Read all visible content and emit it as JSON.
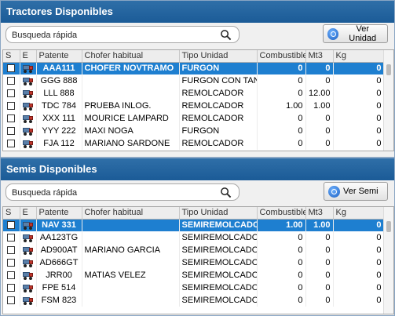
{
  "tractores": {
    "title": "Tractores Disponibles",
    "search_placeholder": "Busqueda rápida",
    "button_label": "Ver Unidad",
    "columns": [
      "S",
      "E",
      "Patente",
      "Chofer habitual",
      "Tipo Unidad",
      "Combustible",
      "Mt3",
      "Kg"
    ],
    "rows": [
      {
        "patente": "AAA111",
        "chofer": "CHOFER NOVTRAMO",
        "tipo": "FURGON",
        "combustible": "0",
        "mt3": "0",
        "kg": "0",
        "selected": true
      },
      {
        "patente": "GGG 888",
        "chofer": "",
        "tipo": "FURGON CON TANQUE",
        "combustible": "0",
        "mt3": "0",
        "kg": "0"
      },
      {
        "patente": "LLL 888",
        "chofer": "",
        "tipo": "REMOLCADOR",
        "combustible": "0",
        "mt3": "12.00",
        "kg": "0"
      },
      {
        "patente": "TDC 784",
        "chofer": "PRUEBA INLOG.",
        "tipo": "REMOLCADOR",
        "combustible": "1.00",
        "mt3": "1.00",
        "kg": "0"
      },
      {
        "patente": "XXX 111",
        "chofer": "MOURICE LAMPARD",
        "tipo": "REMOLCADOR",
        "combustible": "0",
        "mt3": "0",
        "kg": "0"
      },
      {
        "patente": "YYY 222",
        "chofer": "MAXI NOGA",
        "tipo": "FURGON",
        "combustible": "0",
        "mt3": "0",
        "kg": "0"
      },
      {
        "patente": "FJA 112",
        "chofer": "MARIANO SARDONE",
        "tipo": "REMOLCADOR",
        "combustible": "0",
        "mt3": "0",
        "kg": "0"
      }
    ]
  },
  "semis": {
    "title": "Semis Disponibles",
    "search_placeholder": "Busqueda rápida",
    "button_label": "Ver Semi",
    "columns": [
      "S",
      "E",
      "Patente",
      "Chofer habitual",
      "Tipo Unidad",
      "Combustible",
      "Mt3",
      "Kg"
    ],
    "rows": [
      {
        "patente": "NAV 331",
        "chofer": "",
        "tipo": "SEMIREMOLCADOR",
        "combustible": "1.00",
        "mt3": "1.00",
        "kg": "0",
        "selected": true
      },
      {
        "patente": "AA123TG",
        "chofer": "",
        "tipo": "SEMIREMOLCADOR",
        "combustible": "0",
        "mt3": "0",
        "kg": "0"
      },
      {
        "patente": "AD900AT",
        "chofer": "MARIANO GARCIA",
        "tipo": "SEMIREMOLCADOR",
        "combustible": "0",
        "mt3": "0",
        "kg": "0"
      },
      {
        "patente": "AD666GT",
        "chofer": "",
        "tipo": "SEMIREMOLCADOR",
        "combustible": "0",
        "mt3": "0",
        "kg": "0"
      },
      {
        "patente": "JRR00",
        "chofer": "MATIAS VELEZ",
        "tipo": "SEMIREMOLCADOR",
        "combustible": "0",
        "mt3": "0",
        "kg": "0"
      },
      {
        "patente": "FPE 514",
        "chofer": "",
        "tipo": "SEMIREMOLCADOR",
        "combustible": "0",
        "mt3": "0",
        "kg": "0"
      },
      {
        "patente": "FSM 823",
        "chofer": "",
        "tipo": "SEMIREMOLCADOR",
        "combustible": "0",
        "mt3": "0",
        "kg": "0"
      }
    ]
  }
}
